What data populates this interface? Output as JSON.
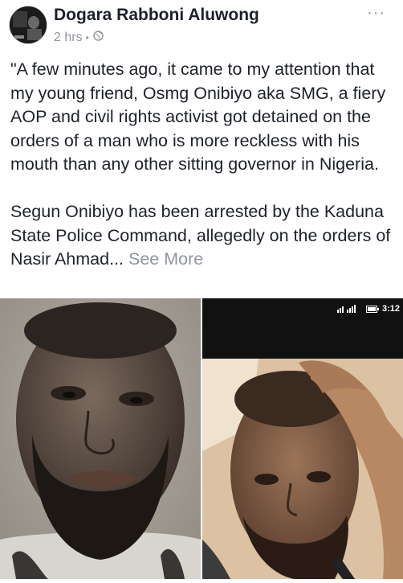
{
  "post": {
    "author": "Dogara Rabboni Aluwong",
    "time": "2 hrs",
    "separator": "•",
    "more_glyph": "···",
    "text_paragraphs": [
      "\"A few minutes ago, it came to my attention that my young friend, Osmg Onibiyo aka SMG, a fiery AOP and civil rights activist got detained on the orders of a man who is more reckless with his mouth than any other sitting governor in Nigeria.",
      "Segun Onibiyo has been arrested by the Kaduna State Police Command, allegedly on the orders of Nasir Ahmad..."
    ],
    "see_more": "See More",
    "privacy_icon": "globe-icon"
  },
  "photos": {
    "right_status_time": "3:12"
  },
  "colors": {
    "text": "#1d2129",
    "secondary": "#90949c"
  }
}
